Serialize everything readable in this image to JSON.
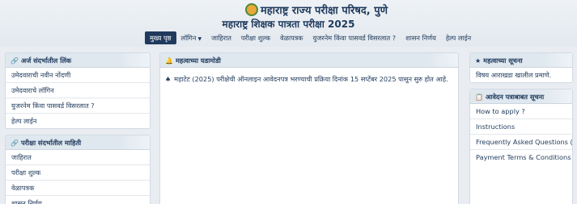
{
  "header": {
    "org_title": "महाराष्ट्र राज्य परीक्षा परिषद, पुणे",
    "exam_title": "महाराष्ट्र शिक्षक पात्रता परीक्षा 2025"
  },
  "nav": {
    "items": [
      {
        "label": "मुख्य पृष्ठ"
      },
      {
        "label": "लॉगिन"
      },
      {
        "label": "जाहिरात"
      },
      {
        "label": "परीक्षा शुल्क"
      },
      {
        "label": "वेळापत्रक"
      },
      {
        "label": "युजरनेम किंवा पासवर्ड विसरलात ?"
      },
      {
        "label": "शासन निर्णय"
      },
      {
        "label": "हेल्प लाईन"
      }
    ]
  },
  "left_panel_1": {
    "title": "अर्ज संदर्भातील लिंक",
    "items": [
      "उमेदवाराची नवीन नोंदणी",
      "उमेदवाराचे लॉगिन",
      "युजरनेम किंवा पासवर्ड विसरलात ?",
      "हेल्प लाईन"
    ]
  },
  "left_panel_2": {
    "title": "परीक्षा संदर्भातील माहिती",
    "items": [
      "जाहिरात",
      "परीक्षा शुल्क",
      "वेळापत्रक",
      "शासन निर्णय"
    ]
  },
  "center_panel": {
    "title": "महत्वाच्या घडामोडी",
    "news": "महाटेट (2025) परीक्षेची ऑनलाइन आवेदनपत्र भरण्याची प्रक्रिया दिनांक 15 सप्टेंबर 2025 पासून सुरु होत आहे."
  },
  "right_panel_1": {
    "title": "महत्वाच्या सूचना",
    "items": [
      "विषय आराखडा खालील प्रमाणे."
    ]
  },
  "right_panel_2": {
    "title": "आवेदन पत्राबाबत सूचना",
    "items": [
      "How to apply ?",
      "Instructions",
      "Frequently Asked Questions (FAQ)",
      "Payment Terms & Conditions"
    ]
  }
}
